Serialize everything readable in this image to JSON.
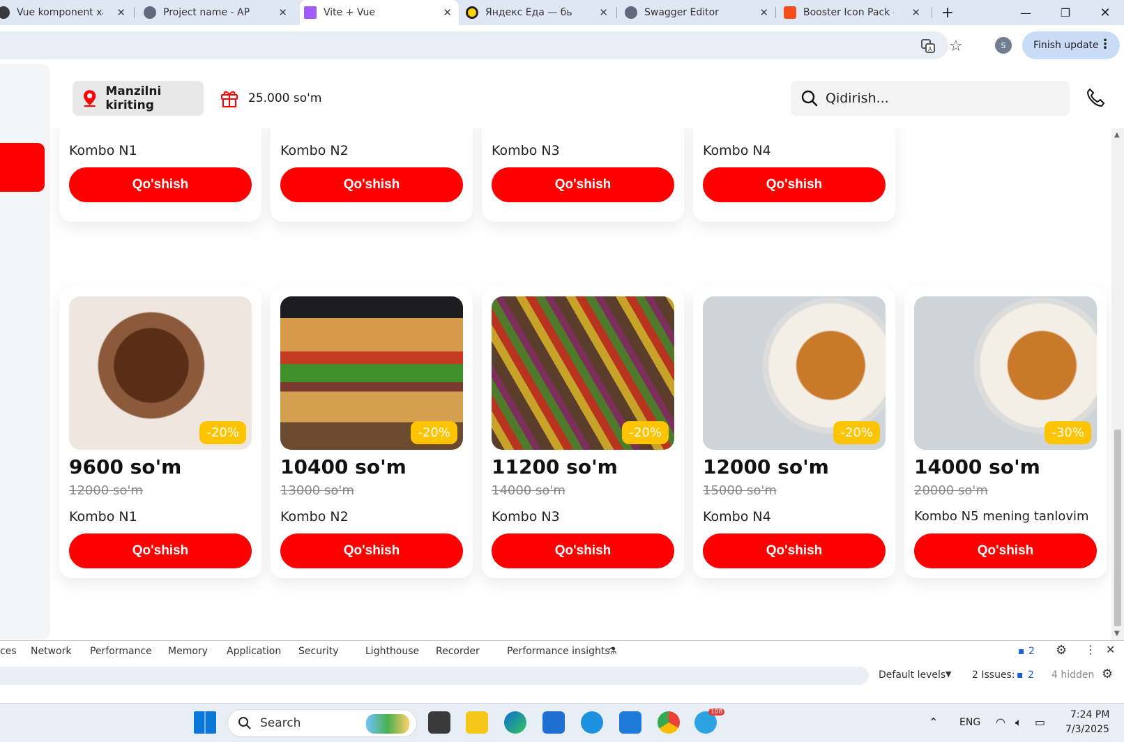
{
  "browser": {
    "tabs": [
      {
        "title": "Vue komponent xato",
        "favicon_color": "#3a3a3a"
      },
      {
        "title": "Project name - API Pl",
        "favicon_color": "#5f6b7a"
      },
      {
        "title": "Vite + Vue",
        "favicon_color": "#a05cff"
      },
      {
        "title": "Яндекс Еда — быстр",
        "favicon_color": "#ffd400"
      },
      {
        "title": "Swagger Editor",
        "favicon_color": "#5f6b7a"
      },
      {
        "title": "Booster Icon Pack - E",
        "favicon_color": "#f24e1e"
      }
    ],
    "avatar_letter": "S",
    "finish_update": "Finish update"
  },
  "header": {
    "address_button": "Manzilni kiriting",
    "bonus": "25.000 so'm",
    "search_placeholder": "Qidirish..."
  },
  "top_row": [
    {
      "price": "12000 so'm",
      "name": "Kombo N1",
      "button": "Qo'shish"
    },
    {
      "price": "13000 so'm",
      "name": "Kombo N2",
      "button": "Qo'shish"
    },
    {
      "price": "14000 so'm",
      "name": "Kombo N3",
      "button": "Qo'shish"
    },
    {
      "price": "15000 so'm",
      "name": "Kombo N4",
      "button": "Qo'shish"
    }
  ],
  "products": [
    {
      "discount": "-20%",
      "price": "9600 so'm",
      "old_price": "12000 so'm",
      "name": "Kombo N1",
      "button": "Qo'shish",
      "image": "chocolate-lava-cake"
    },
    {
      "discount": "-20%",
      "price": "10400 so'm",
      "old_price": "13000 so'm",
      "name": "Kombo N2",
      "button": "Qo'shish",
      "image": "burger"
    },
    {
      "discount": "-20%",
      "price": "11200 so'm",
      "old_price": "14000 so'm",
      "name": "Kombo N3",
      "button": "Qo'shish",
      "image": "vegetable-skewers"
    },
    {
      "discount": "-20%",
      "price": "12000 so'm",
      "old_price": "15000 so'm",
      "name": "Kombo N4",
      "button": "Qo'shish",
      "image": "rice-vegetable-bowl"
    },
    {
      "discount": "-30%",
      "price": "14000 so'm",
      "old_price": "20000 so'm",
      "name": "Kombo N5 mening tanlovim",
      "button": "Qo'shish",
      "image": "rice-vegetable-bowl"
    }
  ],
  "devtools": {
    "tabs": [
      "ces",
      "Network",
      "Performance",
      "Memory",
      "Application",
      "Security",
      "Lighthouse",
      "Recorder",
      "Performance insights"
    ],
    "issues_badge": "2",
    "default_levels": "Default levels",
    "issues_label": "2 Issues:",
    "issues_count": "2",
    "hidden": "4 hidden"
  },
  "taskbar": {
    "search": "Search",
    "lang": "ENG",
    "time": "7:24 PM",
    "date": "7/3/2025",
    "telegram_badge": "108"
  },
  "colors": {
    "accent": "#ff0000",
    "discount": "#ffc400"
  }
}
